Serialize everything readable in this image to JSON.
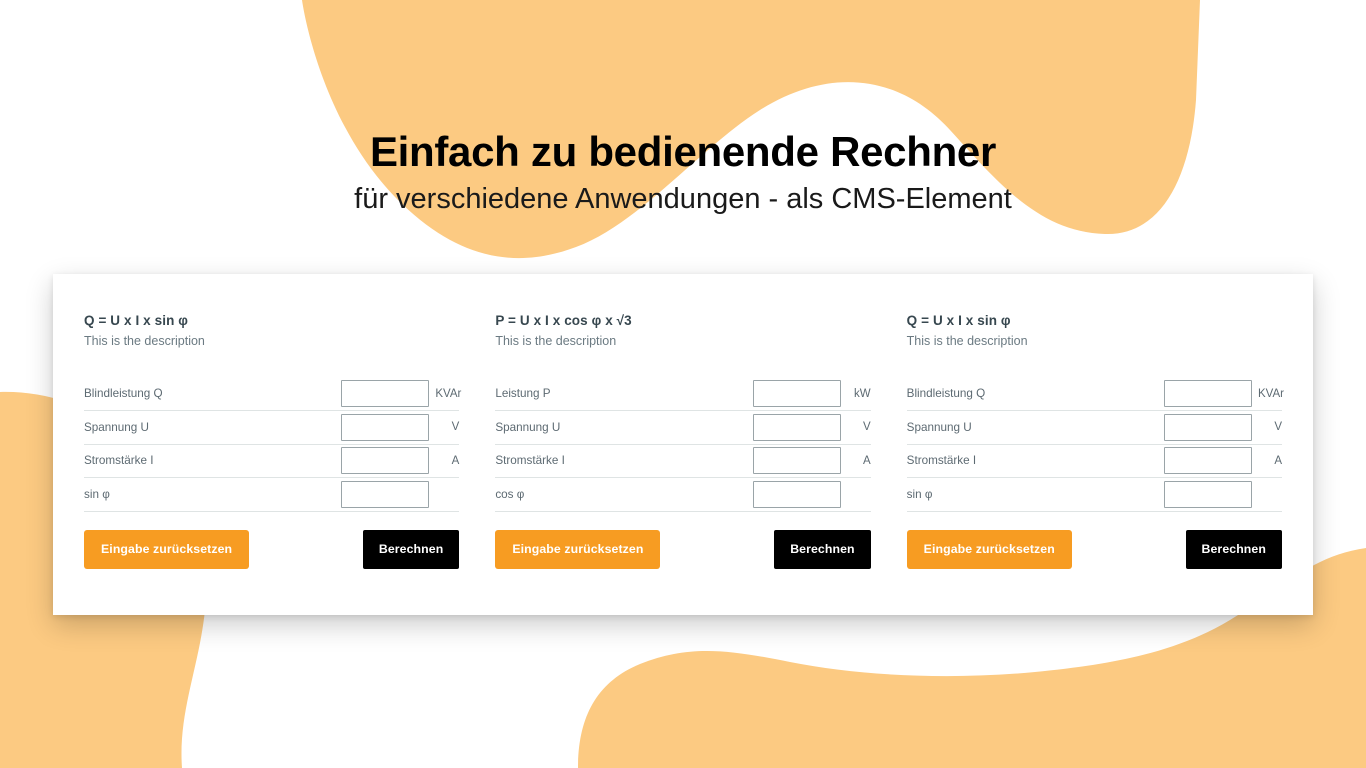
{
  "hero": {
    "title": "Einfach zu bedienende Rechner",
    "subtitle": "für verschiedene Anwendungen - als CMS-Element"
  },
  "colors": {
    "blob_orange": "#fcca82",
    "button_orange": "#f79c22",
    "button_black": "#000000",
    "panel_white": "#ffffff",
    "heading_text": "#37474f",
    "label_text": "#5d6a72",
    "divider": "#dfe4e4",
    "input_border": "#9aa4a8"
  },
  "calculators": [
    {
      "title": "Q = U x I x sin φ",
      "description": "This is the description",
      "rows": [
        {
          "label": "Blindleistung Q",
          "value": "",
          "placeholder": "",
          "unit": "KVAr"
        },
        {
          "label": "Spannung U",
          "value": "",
          "placeholder": "",
          "unit": "V"
        },
        {
          "label": "Stromstärke I",
          "value": "",
          "placeholder": "",
          "unit": "A"
        },
        {
          "label": "sin φ",
          "value": "",
          "placeholder": "",
          "unit": ""
        }
      ],
      "reset_label": "Eingabe zurücksetzen",
      "calc_label": "Berechnen"
    },
    {
      "title": "P = U x I x cos φ x √3",
      "description": "This is the description",
      "rows": [
        {
          "label": "Leistung P",
          "value": "",
          "placeholder": "",
          "unit": "kW"
        },
        {
          "label": "Spannung U",
          "value": "",
          "placeholder": "",
          "unit": "V"
        },
        {
          "label": "Stromstärke I",
          "value": "",
          "placeholder": "",
          "unit": "A"
        },
        {
          "label": "cos φ",
          "value": "",
          "placeholder": "",
          "unit": ""
        }
      ],
      "reset_label": "Eingabe zurücksetzen",
      "calc_label": "Berechnen"
    },
    {
      "title": "Q = U x I x sin φ",
      "description": "This is the description",
      "rows": [
        {
          "label": "Blindleistung Q",
          "value": "",
          "placeholder": "",
          "unit": "KVAr"
        },
        {
          "label": "Spannung U",
          "value": "",
          "placeholder": "",
          "unit": "V"
        },
        {
          "label": "Stromstärke I",
          "value": "",
          "placeholder": "",
          "unit": "A"
        },
        {
          "label": "sin φ",
          "value": "",
          "placeholder": "",
          "unit": ""
        }
      ],
      "reset_label": "Eingabe zurücksetzen",
      "calc_label": "Berechnen"
    }
  ]
}
